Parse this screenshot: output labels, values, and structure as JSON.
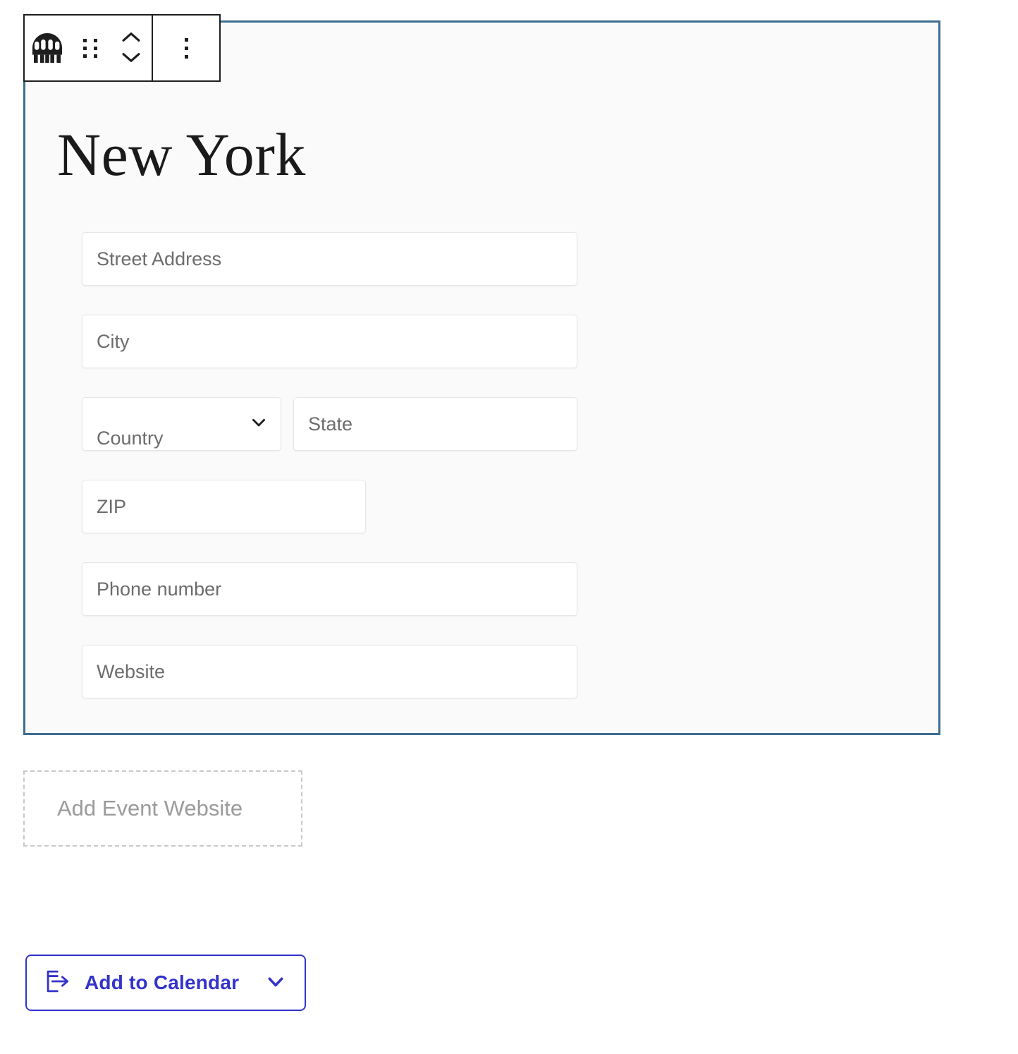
{
  "block": {
    "name": "venue-block",
    "border_color": "#3e6d90",
    "background_color": "#fafafa",
    "selected": true
  },
  "toolbar": {
    "block_type_icon": "venue-icon",
    "drag_handle_icon": "drag-handle-icon",
    "move_up_icon": "chevron-up-icon",
    "move_down_icon": "chevron-down-icon",
    "more_options_icon": "kebab-menu-icon"
  },
  "venue": {
    "title": "New York",
    "fields": {
      "street": {
        "label": "street-address",
        "placeholder": "Street Address",
        "value": ""
      },
      "city": {
        "label": "city",
        "placeholder": "City",
        "value": ""
      },
      "country": {
        "label": "country",
        "placeholder": "Country",
        "value": "Country"
      },
      "state": {
        "label": "state",
        "placeholder": "State",
        "value": ""
      },
      "zip": {
        "label": "zip",
        "placeholder": "ZIP",
        "value": ""
      },
      "phone": {
        "label": "phone",
        "placeholder": "Phone number",
        "value": ""
      },
      "website": {
        "label": "website",
        "placeholder": "Website",
        "value": ""
      }
    }
  },
  "placeholders": {
    "add_event_website": "Add Event Website"
  },
  "calendar_button": {
    "label": "Add to Calendar",
    "accent_color": "#3333cc",
    "icon": "calendar-export-icon",
    "chevron_icon": "chevron-down-icon"
  }
}
